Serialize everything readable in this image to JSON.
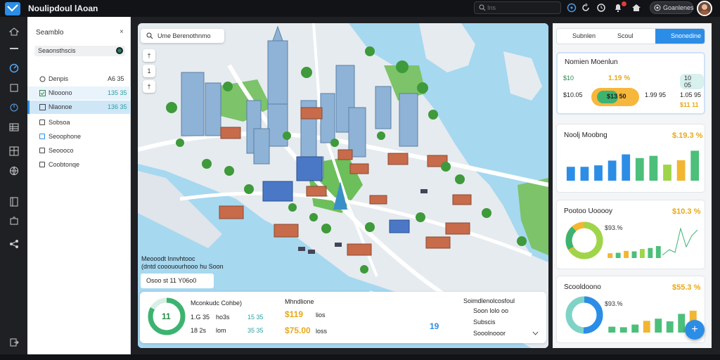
{
  "topbar": {
    "title": "Noulipdoul lAoan",
    "search_placeholder": "Ins",
    "user_label": "Goanlenes",
    "icons": [
      "logo-icon",
      "search-icon",
      "info-icon",
      "refresh-icon",
      "clock-icon",
      "bell-icon",
      "house-icon",
      "user-icon",
      "avatar"
    ]
  },
  "rail": {
    "icons": [
      "dashboard-icon",
      "minus-icon",
      "speed-icon",
      "square-icon",
      "power-icon",
      "table-icon",
      "layout-icon",
      "globe-icon",
      "book-icon",
      "puzzle-icon",
      "share-icon",
      "exit-icon"
    ]
  },
  "panel": {
    "header": "Seamblo",
    "close": "×",
    "top_row": "Seaonsthscis",
    "rows": [
      {
        "icon": "circle-icon",
        "label": "Denpis",
        "value": "A6 35"
      },
      {
        "icon": "check-icon",
        "label": "Nlooono",
        "value": "135 35"
      },
      {
        "icon": "chart-icon",
        "label": "Nlaonoe",
        "value": "136 35"
      },
      {
        "icon": "box-icon",
        "label": "Sobsoa",
        "value": ""
      },
      {
        "icon": "chat-icon",
        "label": "Seoophone",
        "value": ""
      },
      {
        "icon": "square-icon",
        "label": "Seoooco",
        "value": ""
      },
      {
        "icon": "square-icon",
        "label": "Coobtonqe",
        "value": ""
      }
    ]
  },
  "map": {
    "chip_label": "Ume Berenothnmo",
    "buttons": [
      "†",
      "1",
      "†"
    ],
    "legend_line1": "Meooodt Innvhtooc",
    "legend_line2": "(dntd cooouourhooo hu Soon",
    "box_label": "Osoo st  11  Y06o0"
  },
  "bottom": {
    "ring_value": "11",
    "col1": {
      "title": "Mconkudc Cohbe)",
      "row1_label": "1.G 35",
      "row1_sub": "ho3s",
      "row2_label": "18 2s",
      "row2_sub": "lom"
    },
    "col1_vals": [
      "15 35",
      "35 35"
    ],
    "col2": {
      "title": "Mhndlione",
      "val1": "$119",
      "val1_sub": "lios",
      "val2": "$75.00",
      "val2_sub": "loss"
    },
    "col3": {
      "title": "Soimdlenolcosfoul",
      "items": [
        "Soon lolo oo",
        "Subscis",
        "Sooolnooor"
      ],
      "glyph": "19"
    }
  },
  "right": {
    "tabs": [
      "Subnlen",
      "Scoul",
      "Snonedine"
    ],
    "summary": {
      "title": "Nomien Moenlun",
      "row1_left": "$10",
      "row1_mid": "1.19 %",
      "row1_right": "10 05",
      "row2_left": "$10.05",
      "row2_center": "$13 50",
      "row2_mid": "1.99 95",
      "row2_right": "1.05 95",
      "row2_sub": "$11 11"
    },
    "card1": {
      "title": "Noolj Moobng",
      "pct": "$.19.3 %"
    },
    "card2": {
      "title": "Pootoo Uooooy",
      "pct": "$10.3 %",
      "inner": "$93.%"
    },
    "card3": {
      "title": "Scooldoono",
      "pct": "$55.3 %",
      "inner": "$93.%"
    }
  },
  "chart_data": [
    {
      "type": "bar",
      "title": "Noolj Moobng",
      "categories": [
        "1",
        "2",
        "3",
        "4",
        "5",
        "6",
        "7",
        "8",
        "9",
        "10"
      ],
      "values": [
        38,
        38,
        42,
        55,
        72,
        62,
        68,
        44,
        56,
        82
      ],
      "colors": [
        "#2c8de6",
        "#2c8de6",
        "#2c8de6",
        "#2c8de6",
        "#2c8de6",
        "#4cbf7a",
        "#4cbf7a",
        "#9fd54a",
        "#f2b632",
        "#4cbf7a"
      ],
      "ylim": [
        0,
        100
      ]
    },
    {
      "type": "bar",
      "title": "Pootoo Uooooy",
      "categories": [
        "1",
        "2",
        "3",
        "4",
        "5",
        "6",
        "7"
      ],
      "values": [
        20,
        22,
        30,
        28,
        38,
        42,
        50
      ],
      "colors": [
        "#f2b632",
        "#4cbf7a",
        "#f2b632",
        "#4cbf7a",
        "#9fd54a",
        "#4cbf7a",
        "#4cbf7a"
      ],
      "ylim": [
        0,
        100
      ]
    },
    {
      "type": "bar",
      "title": "Scooldoono",
      "categories": [
        "1",
        "2",
        "3",
        "4",
        "5",
        "6",
        "7",
        "8"
      ],
      "values": [
        22,
        20,
        30,
        44,
        52,
        42,
        70,
        82
      ],
      "colors": [
        "#4cbf7a",
        "#4cbf7a",
        "#4cbf7a",
        "#f2b632",
        "#4cbf7a",
        "#4cbf7a",
        "#4cbf7a",
        "#f2b632"
      ],
      "ylim": [
        0,
        100
      ]
    }
  ]
}
